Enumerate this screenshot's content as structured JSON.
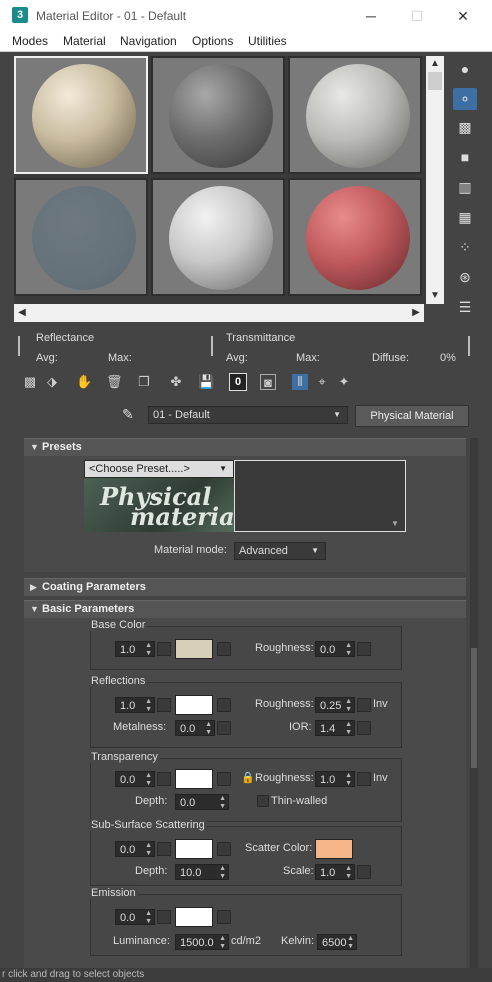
{
  "window": {
    "title": "Material Editor - 01 - Default",
    "app_icon": "3",
    "min_icon": "─",
    "max_icon": "☐",
    "close_icon": "✕"
  },
  "menu": [
    "Modes",
    "Material",
    "Navigation",
    "Options",
    "Utilities"
  ],
  "stats": {
    "reflectance": "Reflectance",
    "transmittance": "Transmittance",
    "avg": "Avg:",
    "max": "Max:",
    "diffuse": "Diffuse:",
    "diffuse_value": "0%"
  },
  "toolbar": {
    "material_id": "0"
  },
  "material": {
    "name": "01 - Default",
    "type_button": "Physical Material"
  },
  "presets": {
    "title": "Presets",
    "choose": "<Choose Preset.....>",
    "logo_line1": "Physical",
    "logo_line2": "material",
    "mode_label": "Material mode:",
    "mode_value": "Advanced"
  },
  "coating": {
    "title": "Coating Parameters"
  },
  "basic": {
    "title": "Basic Parameters",
    "base_color": {
      "title": "Base Color",
      "weight": "1.0",
      "roughness_label": "Roughness:",
      "roughness": "0.0",
      "color": "#d8cfb8"
    },
    "reflections": {
      "title": "Reflections",
      "weight": "1.0",
      "roughness_label": "Roughness:",
      "roughness": "0.25",
      "inv": "Inv",
      "metalness_label": "Metalness:",
      "metalness": "0.0",
      "ior_label": "IOR:",
      "ior": "1.4"
    },
    "transparency": {
      "title": "Transparency",
      "weight": "0.0",
      "roughness_label": "Roughness:",
      "roughness": "1.0",
      "inv": "Inv",
      "depth_label": "Depth:",
      "depth": "0.0",
      "thin_walled": "Thin-walled"
    },
    "sss": {
      "title": "Sub-Surface Scattering",
      "weight": "0.0",
      "scatter_label": "Scatter Color:",
      "scatter_color": "#f6b489",
      "depth_label": "Depth:",
      "depth": "10.0",
      "scale_label": "Scale:",
      "scale": "1.0"
    },
    "emission": {
      "title": "Emission",
      "weight": "0.0",
      "luminance_label": "Luminance:",
      "luminance": "1500.0",
      "luminance_unit": "cd/m2",
      "kelvin_label": "Kelvin:",
      "kelvin": "6500"
    }
  },
  "status_text": "r click and drag to select objects"
}
